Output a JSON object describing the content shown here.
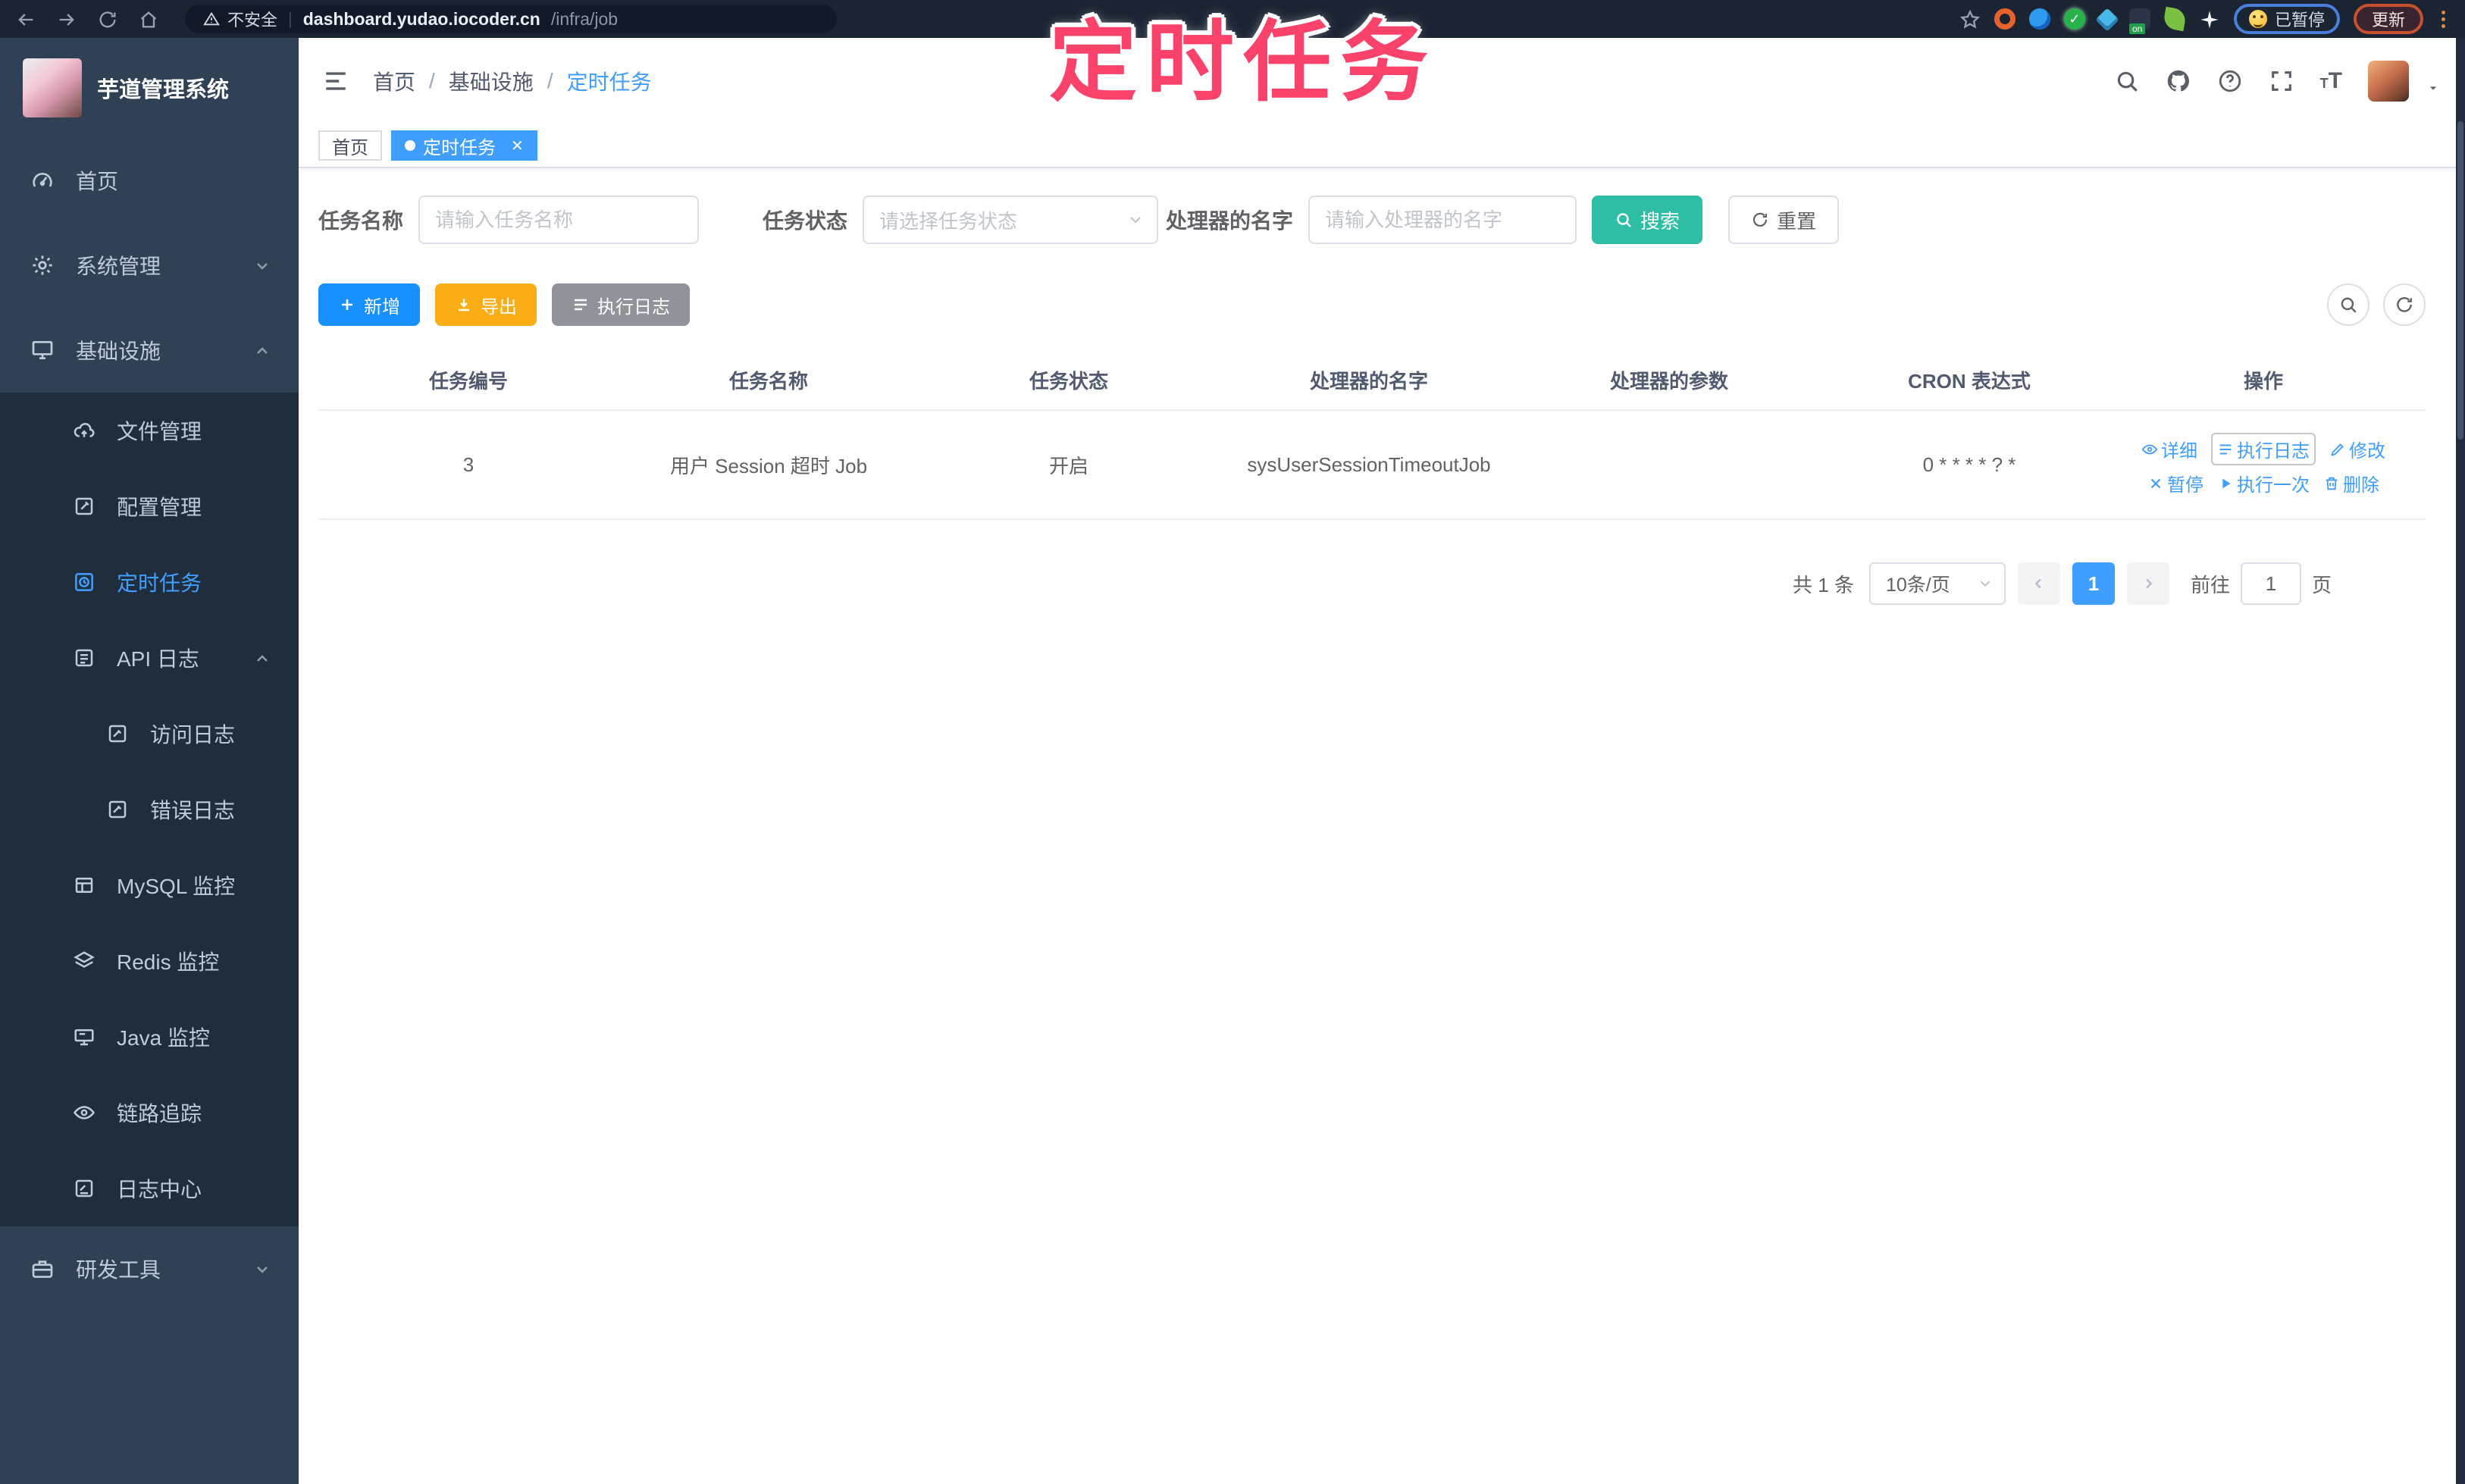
{
  "browser": {
    "security_label": "不安全",
    "url_host": "dashboard.yudao.iocoder.cn",
    "url_path": "/infra/job",
    "ext_on_badge": "on",
    "paused_label": "已暂停",
    "update_label": "更新"
  },
  "annotation": {
    "text": "定时任务",
    "color": "#fb426b"
  },
  "sidebar": {
    "title": "芋道管理系统",
    "items": [
      {
        "label": "首页",
        "icon": "gauge-icon",
        "level": 1
      },
      {
        "label": "系统管理",
        "icon": "gear-icon",
        "level": 1,
        "chevron": "down"
      },
      {
        "label": "基础设施",
        "icon": "monitor-icon",
        "level": 1,
        "chevron": "up"
      },
      {
        "label": "文件管理",
        "icon": "cloud-upload-icon",
        "level": 2
      },
      {
        "label": "配置管理",
        "icon": "edit-square-icon",
        "level": 2
      },
      {
        "label": "定时任务",
        "icon": "timer-icon",
        "level": 2,
        "active": true
      },
      {
        "label": "API 日志",
        "icon": "log-icon",
        "level": 2,
        "chevron": "up"
      },
      {
        "label": "访问日志",
        "icon": "doc-edit-icon",
        "level": 3
      },
      {
        "label": "错误日志",
        "icon": "doc-edit-icon",
        "level": 3
      },
      {
        "label": "MySQL 监控",
        "icon": "database-icon",
        "level": 2
      },
      {
        "label": "Redis 监控",
        "icon": "layers-icon",
        "level": 2
      },
      {
        "label": "Java 监控",
        "icon": "java-monitor-icon",
        "level": 2
      },
      {
        "label": "链路追踪",
        "icon": "eye-icon",
        "level": 2
      },
      {
        "label": "日志中心",
        "icon": "log-center-icon",
        "level": 2
      },
      {
        "label": "研发工具",
        "icon": "briefcase-icon",
        "level": 1,
        "chevron": "down"
      }
    ]
  },
  "header": {
    "breadcrumb": [
      "首页",
      "基础设施",
      "定时任务"
    ],
    "separator": "/"
  },
  "tabs": [
    {
      "label": "首页",
      "active": false
    },
    {
      "label": "定时任务",
      "active": true,
      "closable": true
    }
  ],
  "filters": {
    "name_label": "任务名称",
    "name_placeholder": "请输入任务名称",
    "status_label": "任务状态",
    "status_placeholder": "请选择任务状态",
    "handler_label": "处理器的名字",
    "handler_placeholder": "请输入处理器的名字",
    "search_label": "搜索",
    "reset_label": "重置"
  },
  "toolbar": {
    "add_label": "新增",
    "export_label": "导出",
    "exec_log_label": "执行日志"
  },
  "table": {
    "columns": [
      "任务编号",
      "任务名称",
      "任务状态",
      "处理器的名字",
      "处理器的参数",
      "CRON 表达式",
      "操作"
    ],
    "rows": [
      {
        "id": "3",
        "name": "用户 Session 超时 Job",
        "status": "开启",
        "handler": "sysUserSessionTimeoutJob",
        "param": "",
        "cron": "0 * * * * ? *"
      }
    ],
    "row_actions": [
      "详细",
      "执行日志",
      "修改",
      "暂停",
      "执行一次",
      "删除"
    ]
  },
  "pagination": {
    "total": "共 1 条",
    "page_size": "10条/页",
    "current_page": "1",
    "goto_label": "前往",
    "goto_value": "1",
    "page_unit": "页"
  },
  "colors": {
    "primary": "#409eff",
    "search_teal": "#2dbea5",
    "export_yellow": "#faad14",
    "info_gray": "#909399",
    "sidebar_bg": "#304156",
    "submenu_bg": "#1f2d3d",
    "annotation_pink": "#fb426b"
  }
}
